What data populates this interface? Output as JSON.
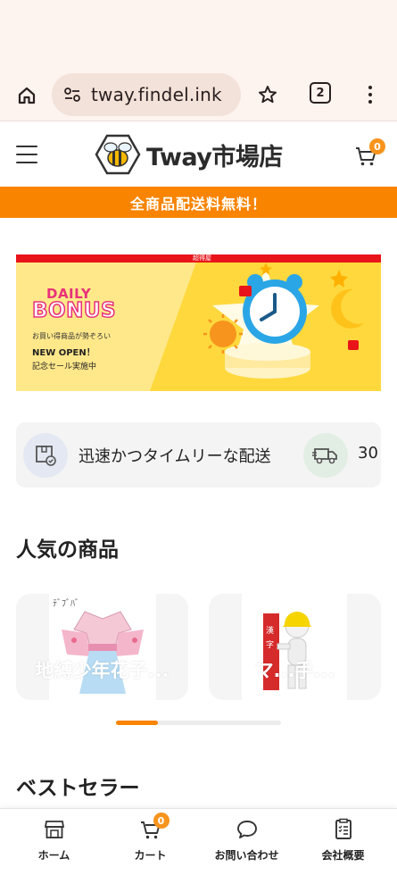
{
  "browser": {
    "url": "tway.findel.ink",
    "tab_count": "2"
  },
  "header": {
    "logo_text": "Tway市場店",
    "cart_count": "0"
  },
  "promo": {
    "text": "全商品配送料無料！"
  },
  "banner": {
    "top_label": "超得屋",
    "daily": "DAILY",
    "bonus": "BONUS",
    "subtitle": "お買い得商品が勢ぞろい",
    "new_open": "NEW OPEN！",
    "sale": "記念セール実施中"
  },
  "features": {
    "items": [
      {
        "icon": "package-check-icon",
        "label": "迅速かつタイムリーな配送"
      },
      {
        "icon": "truck-icon",
        "label": "30"
      }
    ]
  },
  "popular": {
    "title": "人気の商品",
    "products": [
      {
        "name": "地縛少年花子..."
      },
      {
        "name": "マ...手..."
      }
    ]
  },
  "bestseller": {
    "title": "ベストセラー"
  },
  "bottom_nav": {
    "items": [
      {
        "icon": "store-icon",
        "label": "ホーム"
      },
      {
        "icon": "cart-icon",
        "label": "カート",
        "badge": "0"
      },
      {
        "icon": "chat-icon",
        "label": "お問い合わせ"
      },
      {
        "icon": "document-icon",
        "label": "会社概要"
      }
    ]
  },
  "colors": {
    "accent": "#f98400",
    "badge": "#f7941d",
    "browser_bg": "#fdf3ef"
  }
}
